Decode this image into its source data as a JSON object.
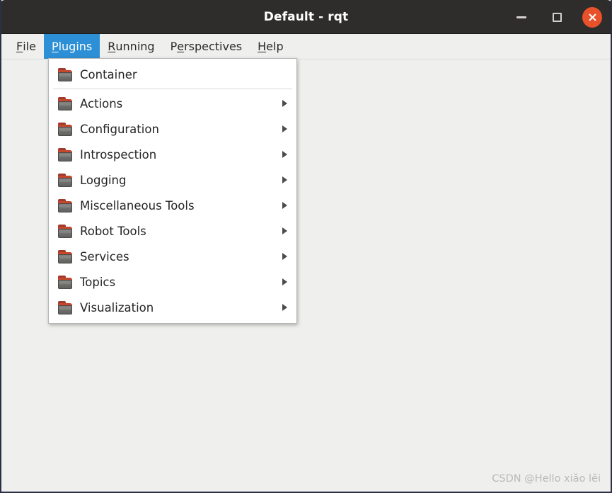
{
  "window": {
    "title": "Default - rqt",
    "controls": {
      "minimize": {
        "name": "minimize-button",
        "glyph": "minimize-icon"
      },
      "maximize": {
        "name": "maximize-button",
        "glyph": "maximize-icon"
      },
      "close": {
        "name": "close-button",
        "glyph": "close-icon"
      }
    },
    "colors": {
      "titlebar_bg": "#2f2d2c",
      "titlebar_text": "#ffffff",
      "close_button_bg": "#e8512a",
      "window_border": "#2b3045",
      "content_bg": "#efefee",
      "menu_highlight": "#2d8fd5",
      "menu_popup_bg": "#ffffff",
      "menu_text": "#242424"
    }
  },
  "menubar": {
    "items": [
      {
        "label": "File",
        "accel_index": 0,
        "active": false
      },
      {
        "label": "Plugins",
        "accel_index": 0,
        "active": true
      },
      {
        "label": "Running",
        "accel_index": 0,
        "active": false
      },
      {
        "label": "Perspectives",
        "accel_index": 1,
        "active": false
      },
      {
        "label": "Help",
        "accel_index": 0,
        "active": false
      }
    ]
  },
  "plugins_menu": {
    "open": true,
    "items": [
      {
        "label": "Container",
        "icon": "folder-icon",
        "submenu": false,
        "separator_after": true
      },
      {
        "label": "Actions",
        "icon": "folder-icon",
        "submenu": true,
        "separator_after": false
      },
      {
        "label": "Configuration",
        "icon": "folder-icon",
        "submenu": true,
        "separator_after": false
      },
      {
        "label": "Introspection",
        "icon": "folder-icon",
        "submenu": true,
        "separator_after": false
      },
      {
        "label": "Logging",
        "icon": "folder-icon",
        "submenu": true,
        "separator_after": false
      },
      {
        "label": "Miscellaneous Tools",
        "icon": "folder-icon",
        "submenu": true,
        "separator_after": false
      },
      {
        "label": "Robot Tools",
        "icon": "folder-icon",
        "submenu": true,
        "separator_after": false
      },
      {
        "label": "Services",
        "icon": "folder-icon",
        "submenu": true,
        "separator_after": false
      },
      {
        "label": "Topics",
        "icon": "folder-icon",
        "submenu": true,
        "separator_after": false
      },
      {
        "label": "Visualization",
        "icon": "folder-icon",
        "submenu": true,
        "separator_after": false
      }
    ]
  },
  "content": {
    "watermark": "CSDN @Hello xiǎo lěi"
  }
}
